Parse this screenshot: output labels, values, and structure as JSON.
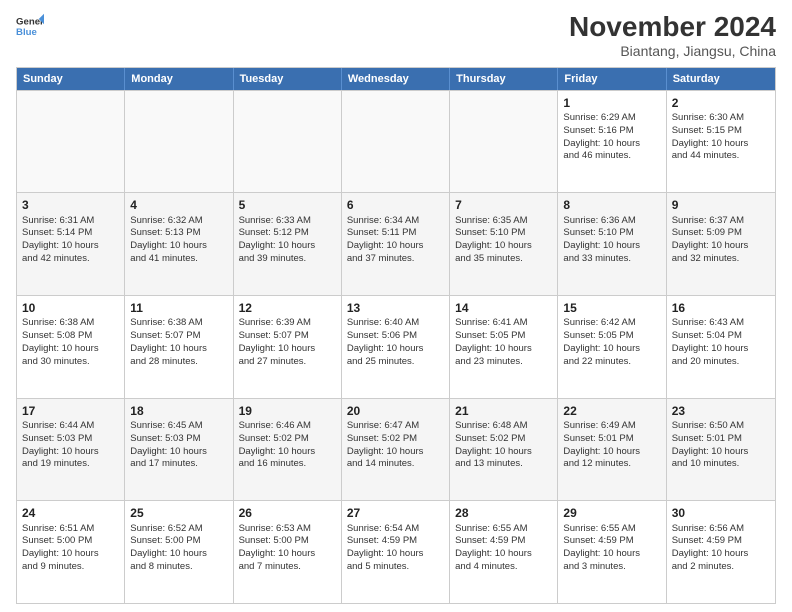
{
  "logo": {
    "line1": "General",
    "line2": "Blue"
  },
  "title": "November 2024",
  "subtitle": "Biantang, Jiangsu, China",
  "days": [
    "Sunday",
    "Monday",
    "Tuesday",
    "Wednesday",
    "Thursday",
    "Friday",
    "Saturday"
  ],
  "weeks": [
    [
      {
        "day": "",
        "content": ""
      },
      {
        "day": "",
        "content": ""
      },
      {
        "day": "",
        "content": ""
      },
      {
        "day": "",
        "content": ""
      },
      {
        "day": "",
        "content": ""
      },
      {
        "day": "1",
        "content": "Sunrise: 6:29 AM\nSunset: 5:16 PM\nDaylight: 10 hours\nand 46 minutes."
      },
      {
        "day": "2",
        "content": "Sunrise: 6:30 AM\nSunset: 5:15 PM\nDaylight: 10 hours\nand 44 minutes."
      }
    ],
    [
      {
        "day": "3",
        "content": "Sunrise: 6:31 AM\nSunset: 5:14 PM\nDaylight: 10 hours\nand 42 minutes."
      },
      {
        "day": "4",
        "content": "Sunrise: 6:32 AM\nSunset: 5:13 PM\nDaylight: 10 hours\nand 41 minutes."
      },
      {
        "day": "5",
        "content": "Sunrise: 6:33 AM\nSunset: 5:12 PM\nDaylight: 10 hours\nand 39 minutes."
      },
      {
        "day": "6",
        "content": "Sunrise: 6:34 AM\nSunset: 5:11 PM\nDaylight: 10 hours\nand 37 minutes."
      },
      {
        "day": "7",
        "content": "Sunrise: 6:35 AM\nSunset: 5:10 PM\nDaylight: 10 hours\nand 35 minutes."
      },
      {
        "day": "8",
        "content": "Sunrise: 6:36 AM\nSunset: 5:10 PM\nDaylight: 10 hours\nand 33 minutes."
      },
      {
        "day": "9",
        "content": "Sunrise: 6:37 AM\nSunset: 5:09 PM\nDaylight: 10 hours\nand 32 minutes."
      }
    ],
    [
      {
        "day": "10",
        "content": "Sunrise: 6:38 AM\nSunset: 5:08 PM\nDaylight: 10 hours\nand 30 minutes."
      },
      {
        "day": "11",
        "content": "Sunrise: 6:38 AM\nSunset: 5:07 PM\nDaylight: 10 hours\nand 28 minutes."
      },
      {
        "day": "12",
        "content": "Sunrise: 6:39 AM\nSunset: 5:07 PM\nDaylight: 10 hours\nand 27 minutes."
      },
      {
        "day": "13",
        "content": "Sunrise: 6:40 AM\nSunset: 5:06 PM\nDaylight: 10 hours\nand 25 minutes."
      },
      {
        "day": "14",
        "content": "Sunrise: 6:41 AM\nSunset: 5:05 PM\nDaylight: 10 hours\nand 23 minutes."
      },
      {
        "day": "15",
        "content": "Sunrise: 6:42 AM\nSunset: 5:05 PM\nDaylight: 10 hours\nand 22 minutes."
      },
      {
        "day": "16",
        "content": "Sunrise: 6:43 AM\nSunset: 5:04 PM\nDaylight: 10 hours\nand 20 minutes."
      }
    ],
    [
      {
        "day": "17",
        "content": "Sunrise: 6:44 AM\nSunset: 5:03 PM\nDaylight: 10 hours\nand 19 minutes."
      },
      {
        "day": "18",
        "content": "Sunrise: 6:45 AM\nSunset: 5:03 PM\nDaylight: 10 hours\nand 17 minutes."
      },
      {
        "day": "19",
        "content": "Sunrise: 6:46 AM\nSunset: 5:02 PM\nDaylight: 10 hours\nand 16 minutes."
      },
      {
        "day": "20",
        "content": "Sunrise: 6:47 AM\nSunset: 5:02 PM\nDaylight: 10 hours\nand 14 minutes."
      },
      {
        "day": "21",
        "content": "Sunrise: 6:48 AM\nSunset: 5:02 PM\nDaylight: 10 hours\nand 13 minutes."
      },
      {
        "day": "22",
        "content": "Sunrise: 6:49 AM\nSunset: 5:01 PM\nDaylight: 10 hours\nand 12 minutes."
      },
      {
        "day": "23",
        "content": "Sunrise: 6:50 AM\nSunset: 5:01 PM\nDaylight: 10 hours\nand 10 minutes."
      }
    ],
    [
      {
        "day": "24",
        "content": "Sunrise: 6:51 AM\nSunset: 5:00 PM\nDaylight: 10 hours\nand 9 minutes."
      },
      {
        "day": "25",
        "content": "Sunrise: 6:52 AM\nSunset: 5:00 PM\nDaylight: 10 hours\nand 8 minutes."
      },
      {
        "day": "26",
        "content": "Sunrise: 6:53 AM\nSunset: 5:00 PM\nDaylight: 10 hours\nand 7 minutes."
      },
      {
        "day": "27",
        "content": "Sunrise: 6:54 AM\nSunset: 4:59 PM\nDaylight: 10 hours\nand 5 minutes."
      },
      {
        "day": "28",
        "content": "Sunrise: 6:55 AM\nSunset: 4:59 PM\nDaylight: 10 hours\nand 4 minutes."
      },
      {
        "day": "29",
        "content": "Sunrise: 6:55 AM\nSunset: 4:59 PM\nDaylight: 10 hours\nand 3 minutes."
      },
      {
        "day": "30",
        "content": "Sunrise: 6:56 AM\nSunset: 4:59 PM\nDaylight: 10 hours\nand 2 minutes."
      }
    ]
  ]
}
